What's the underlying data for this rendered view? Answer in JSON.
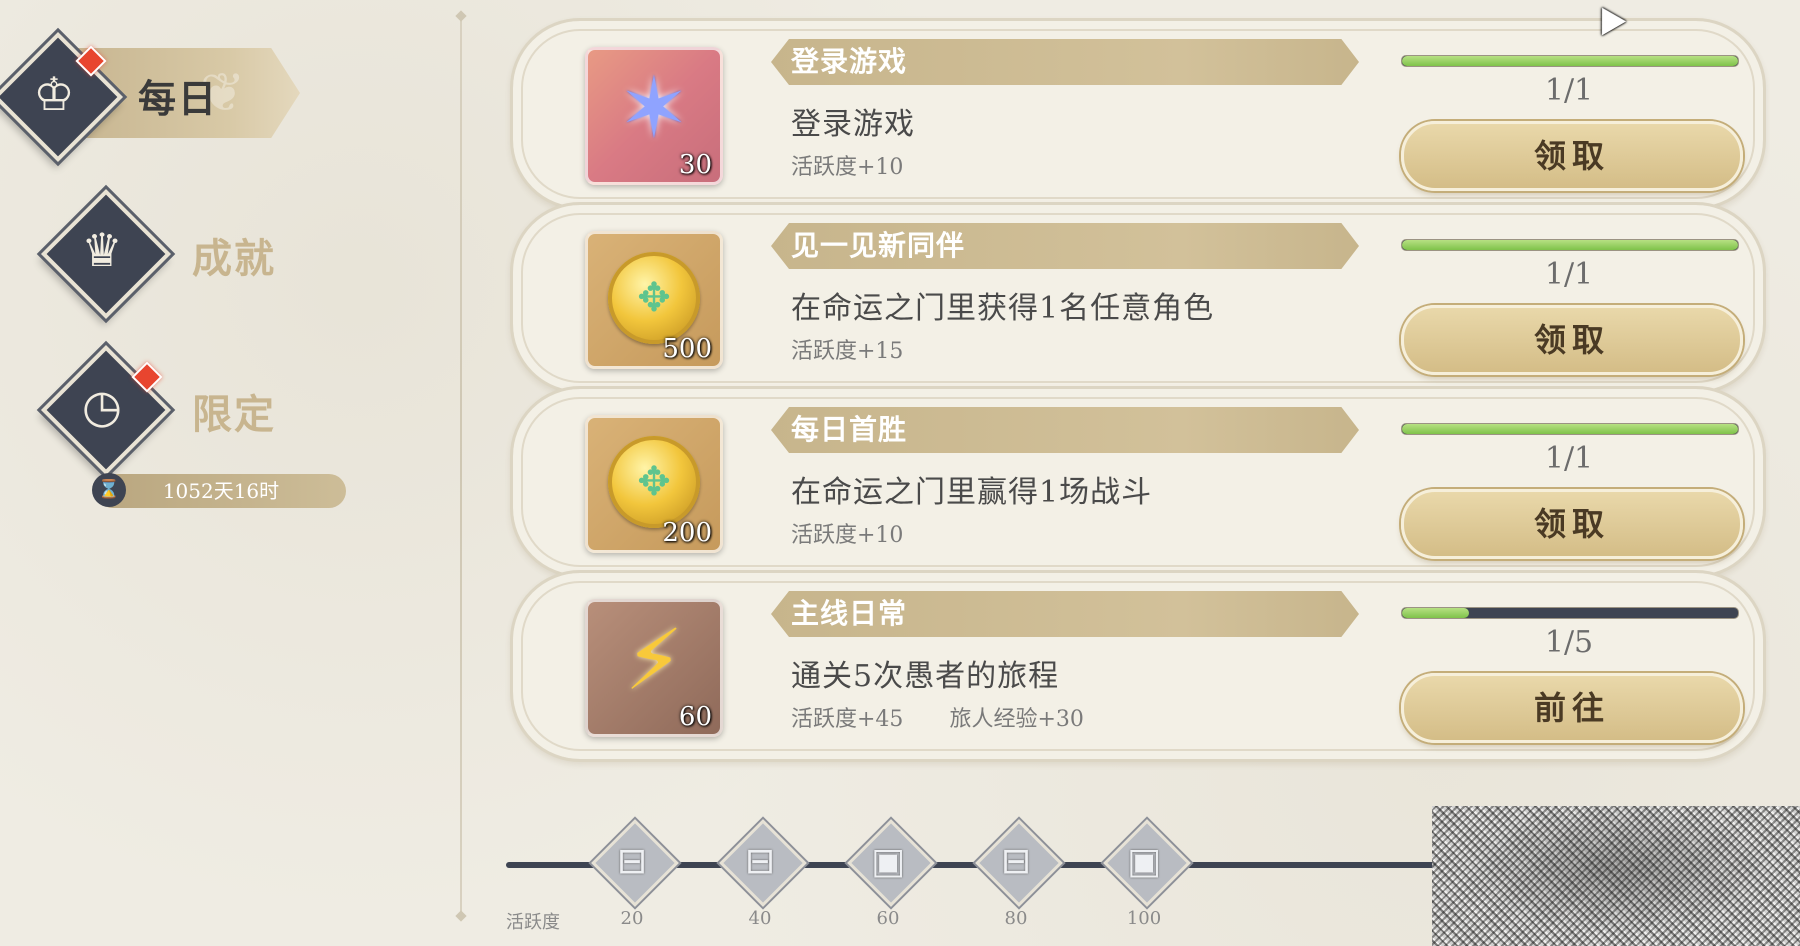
{
  "sidebar": {
    "daily": {
      "label": "每日",
      "icon": "crown-calendar-icon",
      "has_notification": true
    },
    "achievement": {
      "label": "成就",
      "icon": "trophy-icon"
    },
    "limited": {
      "label": "限定",
      "icon": "clock-icon",
      "has_notification": true
    },
    "timer": {
      "text": "1052天16时",
      "icon": "hourglass-icon"
    }
  },
  "tasks": [
    {
      "title": "登录游戏",
      "description": "登录游戏",
      "activity": "活跃度+10",
      "extra": "",
      "reward_icon": "star-crystal-icon",
      "reward_count": "30",
      "progress_text": "1/1",
      "progress_fraction": 1.0,
      "button": "领取"
    },
    {
      "title": "见一见新同伴",
      "description": "在命运之门里获得1名任意角色",
      "activity": "活跃度+15",
      "extra": "",
      "reward_icon": "gold-coin-icon",
      "reward_count": "500",
      "progress_text": "1/1",
      "progress_fraction": 1.0,
      "button": "领取"
    },
    {
      "title": "每日首胜",
      "description": "在命运之门里赢得1场战斗",
      "activity": "活跃度+10",
      "extra": "",
      "reward_icon": "gold-coin-icon",
      "reward_count": "200",
      "progress_text": "1/1",
      "progress_fraction": 1.0,
      "button": "领取"
    },
    {
      "title": "主线日常",
      "description": "通关5次愚者的旅程",
      "activity": "活跃度+45",
      "extra": "旅人经验+30",
      "reward_icon": "lightning-icon",
      "reward_count": "60",
      "progress_text": "1/5",
      "progress_fraction": 0.2,
      "button": "前往"
    }
  ],
  "activity_bar": {
    "label": "活跃度",
    "milestones": [
      {
        "value": "20",
        "icon": "chest-icon"
      },
      {
        "value": "40",
        "icon": "chest-icon"
      },
      {
        "value": "60",
        "icon": "big-chest-icon"
      },
      {
        "value": "80",
        "icon": "chest-icon"
      },
      {
        "value": "100",
        "icon": "big-chest-icon"
      }
    ]
  },
  "colors": {
    "background": "#efece3",
    "accent_gold": "#d4bd87",
    "dark_slate": "#3e4452",
    "progress_green": "#7fc24a",
    "notification_red": "#e8452f"
  }
}
